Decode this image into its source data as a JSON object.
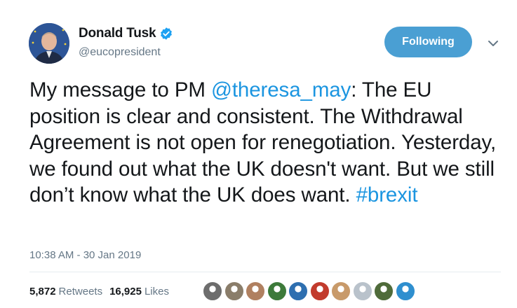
{
  "author": {
    "name": "Donald Tusk",
    "handle": "@eucopresident",
    "verified_color": "#1da1f2"
  },
  "follow_button": {
    "label": "Following",
    "color": "#4a9fd3"
  },
  "tweet": {
    "text_before_mention": "My message to PM ",
    "mention": "@theresa_may",
    "text_after_mention": ": The EU position is clear and consistent. The Withdrawal Agreement is not open for renegotiation. Yesterday, we found out what the UK doesn't want. But we still don’t know what the UK does want. ",
    "hashtag": "#brexit",
    "link_color": "#1b95e0"
  },
  "timestamp": "10:38 AM - 30 Jan 2019",
  "stats": {
    "retweets_count": "5,872",
    "retweets_label": "Retweets",
    "likes_count": "16,925",
    "likes_label": "Likes"
  },
  "likers": [
    {
      "icon": "liker-avatar-1",
      "color": "#6d6d6d"
    },
    {
      "icon": "liker-avatar-2",
      "color": "#8a7d6a"
    },
    {
      "icon": "liker-avatar-3",
      "color": "#b08060"
    },
    {
      "icon": "liker-avatar-4",
      "color": "#3d7a3a"
    },
    {
      "icon": "liker-avatar-5",
      "color": "#2e6fb0"
    },
    {
      "icon": "liker-avatar-6",
      "color": "#c23b2d"
    },
    {
      "icon": "liker-avatar-7",
      "color": "#c89a6a"
    },
    {
      "icon": "liker-avatar-8",
      "color": "#b9c2cb"
    },
    {
      "icon": "liker-avatar-9",
      "color": "#4f6b3a"
    },
    {
      "icon": "liker-avatar-10",
      "color": "#2f8fcf"
    }
  ]
}
